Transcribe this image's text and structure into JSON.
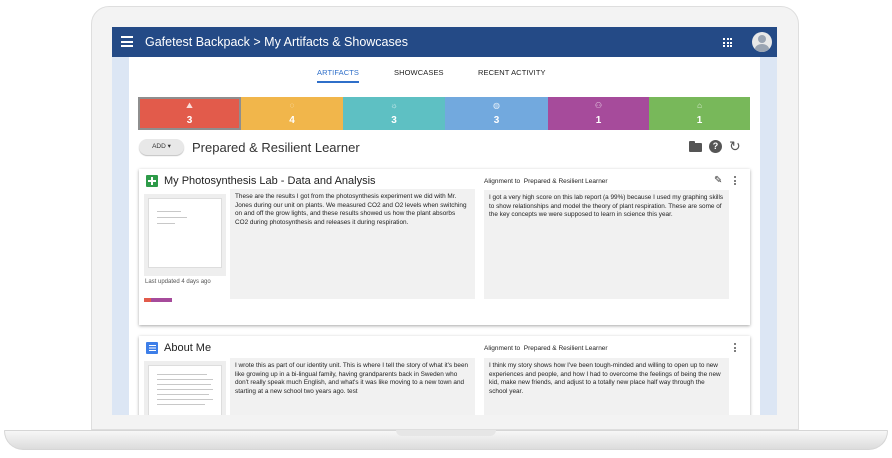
{
  "app": {
    "title": "Gafetest Backpack > My Artifacts & Showcases"
  },
  "tabs": [
    {
      "label": "ARTIFACTS",
      "active": true
    },
    {
      "label": "SHOWCASES",
      "active": false
    },
    {
      "label": "RECENT ACTIVITY",
      "active": false
    }
  ],
  "categories": [
    {
      "count": "3",
      "color": "#e25b4b",
      "icon": "learner-icon",
      "selected": true
    },
    {
      "count": "4",
      "color": "#f1b64b",
      "icon": "chat-icon"
    },
    {
      "count": "3",
      "color": "#5ec0c3",
      "icon": "lightbulb-icon"
    },
    {
      "count": "3",
      "color": "#72a9de",
      "icon": "globe-icon"
    },
    {
      "count": "1",
      "color": "#a64b9b",
      "icon": "people-icon"
    },
    {
      "count": "1",
      "color": "#78b85a",
      "icon": "leaf-icon"
    }
  ],
  "toolbar": {
    "add_label": "ADD ▾",
    "section_title": "Prepared & Resilient Learner",
    "help_glyph": "?",
    "refresh_glyph": "↻"
  },
  "artifacts": [
    {
      "title": "My Photosynthesis Lab - Data and Analysis",
      "description": "These are the results I got from the photosynthesis experiment we did with Mr. Jones during our unit on plants.  We measured CO2 and O2 levels when switching on and off the grow lights, and these results showed us how the plant absorbs CO2 during photosynthesis and releases it during respiration.",
      "updated": "Last updated 4 days ago",
      "alignment_prefix": "Alignment to",
      "alignment_target": "Prepared & Resilient Learner",
      "reflection": "I got a very high score on this lab report (a 99%) because I used my graphing skills to show relationships and model the theory of plant respiration.  These are some of the key concepts we were supposed to learn in science this year.",
      "edit_glyph": "✎"
    },
    {
      "title": "About Me",
      "description": "I wrote this as part of our identity unit.  This is where I tell the story of what it's been like growing up in a bi-lingual family, having grandparents back in Sweden who don't really speak much English, and what's it was like moving to a new town and starting at a new school two years ago. test",
      "alignment_prefix": "Alignment to",
      "alignment_target": "Prepared & Resilient Learner",
      "reflection": "I think my story shows how I've been tough-minded and willing to open up to new experiences and people, and how I had to overcome the feelings of being the new kid, make new friends, and adjust to a totally new place half way through the school year."
    }
  ],
  "colors": {
    "appbar": "#244a86",
    "accent": "#2f6fc9"
  }
}
